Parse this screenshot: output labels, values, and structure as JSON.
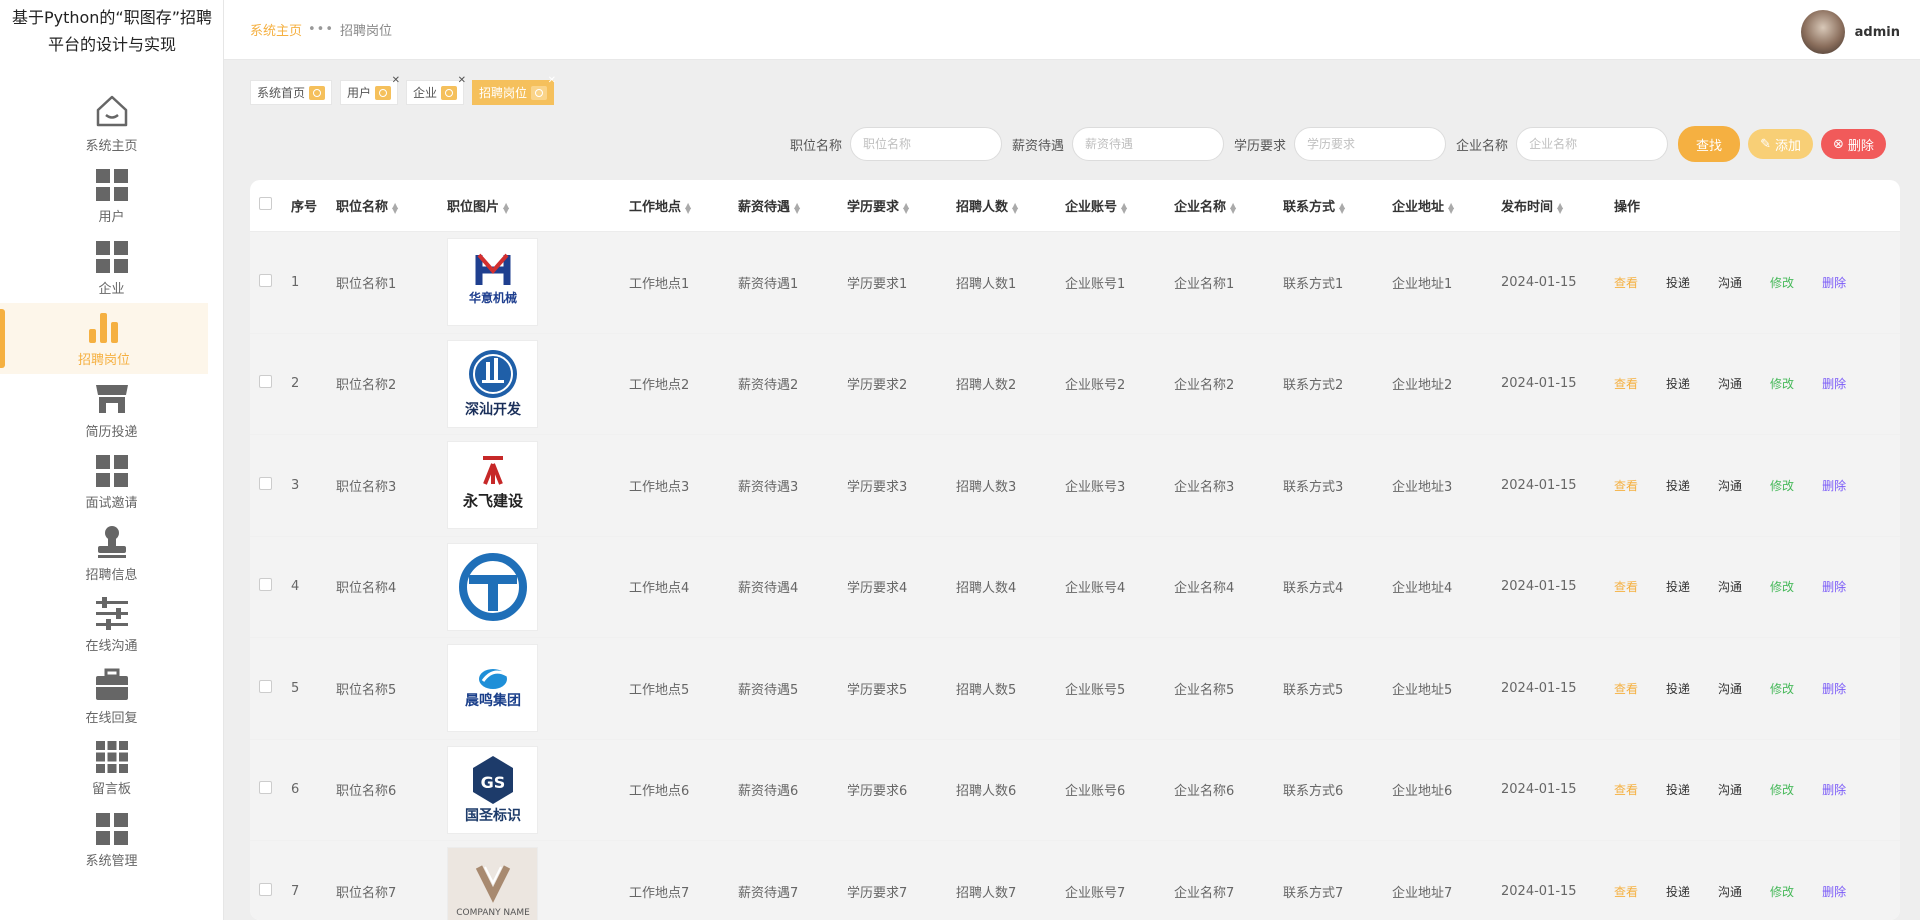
{
  "app": {
    "title": "基于Python的“职图存”招聘平台的设计与实现"
  },
  "sidebar": {
    "items": [
      {
        "label": "系统主页",
        "icon": "house-icon",
        "active": false
      },
      {
        "label": "用户",
        "icon": "grid-icon",
        "active": false
      },
      {
        "label": "企业",
        "icon": "grid-icon",
        "active": false
      },
      {
        "label": "招聘岗位",
        "icon": "bar-chart-icon",
        "active": true
      },
      {
        "label": "简历投递",
        "icon": "shop-icon",
        "active": false
      },
      {
        "label": "面试邀请",
        "icon": "grid-icon",
        "active": false
      },
      {
        "label": "招聘信息",
        "icon": "stamp-icon",
        "active": false
      },
      {
        "label": "在线沟通",
        "icon": "sliders-icon",
        "active": false
      },
      {
        "label": "在线回复",
        "icon": "briefcase-icon",
        "active": false
      },
      {
        "label": "留言板",
        "icon": "grid9-icon",
        "active": false
      },
      {
        "label": "系统管理",
        "icon": "grid-icon",
        "active": false
      }
    ]
  },
  "header": {
    "breadcrumb": {
      "home": "系统主页",
      "separator": "•••",
      "current": "招聘岗位"
    },
    "user": {
      "name": "admin"
    }
  },
  "tags": [
    {
      "label": "系统首页",
      "closable": false,
      "active": false
    },
    {
      "label": "用户",
      "closable": true,
      "active": false
    },
    {
      "label": "企业",
      "closable": true,
      "active": false
    },
    {
      "label": "招聘岗位",
      "closable": true,
      "active": true
    }
  ],
  "search": {
    "fields": [
      {
        "label": "职位名称",
        "placeholder": "职位名称"
      },
      {
        "label": "薪资待遇",
        "placeholder": "薪资待遇"
      },
      {
        "label": "学历要求",
        "placeholder": "学历要求"
      },
      {
        "label": "企业名称",
        "placeholder": "企业名称"
      }
    ],
    "search_label": "查找",
    "add_label": "添加",
    "delete_label": "删除"
  },
  "table": {
    "columns": [
      "序号",
      "职位名称",
      "职位图片",
      "工作地点",
      "薪资待遇",
      "学历要求",
      "招聘人数",
      "企业账号",
      "企业名称",
      "联系方式",
      "企业地址",
      "发布时间",
      "操作"
    ],
    "ops": {
      "view": "查看",
      "deliver": "投递",
      "chat": "沟通",
      "edit": "修改",
      "delete": "删除"
    },
    "rows": [
      {
        "no": "1",
        "name": "职位名称1",
        "logo": "华意机械",
        "location": "工作地点1",
        "salary": "薪资待遇1",
        "education": "学历要求1",
        "count": "招聘人数1",
        "account": "企业账号1",
        "company": "企业名称1",
        "contact": "联系方式1",
        "address": "企业地址1",
        "time": "2024-01-15"
      },
      {
        "no": "2",
        "name": "职位名称2",
        "logo": "深汕开发",
        "location": "工作地点2",
        "salary": "薪资待遇2",
        "education": "学历要求2",
        "count": "招聘人数2",
        "account": "企业账号2",
        "company": "企业名称2",
        "contact": "联系方式2",
        "address": "企业地址2",
        "time": "2024-01-15"
      },
      {
        "no": "3",
        "name": "职位名称3",
        "logo": "永飞建设",
        "location": "工作地点3",
        "salary": "薪资待遇3",
        "education": "学历要求3",
        "count": "招聘人数3",
        "account": "企业账号3",
        "company": "企业名称3",
        "contact": "联系方式3",
        "address": "企业地址3",
        "time": "2024-01-15"
      },
      {
        "no": "4",
        "name": "职位名称4",
        "logo": "",
        "location": "工作地点4",
        "salary": "薪资待遇4",
        "education": "学历要求4",
        "count": "招聘人数4",
        "account": "企业账号4",
        "company": "企业名称4",
        "contact": "联系方式4",
        "address": "企业地址4",
        "time": "2024-01-15"
      },
      {
        "no": "5",
        "name": "职位名称5",
        "logo": "晨鸣集团",
        "location": "工作地点5",
        "salary": "薪资待遇5",
        "education": "学历要求5",
        "count": "招聘人数5",
        "account": "企业账号5",
        "company": "企业名称5",
        "contact": "联系方式5",
        "address": "企业地址5",
        "time": "2024-01-15"
      },
      {
        "no": "6",
        "name": "职位名称6",
        "logo": "国圣标识",
        "location": "工作地点6",
        "salary": "薪资待遇6",
        "education": "学历要求6",
        "count": "招聘人数6",
        "account": "企业账号6",
        "company": "企业名称6",
        "contact": "联系方式6",
        "address": "企业地址6",
        "time": "2024-01-15"
      },
      {
        "no": "7",
        "name": "职位名称7",
        "logo": "COMPANY NAME",
        "location": "工作地点7",
        "salary": "薪资待遇7",
        "education": "学历要求7",
        "count": "招聘人数7",
        "account": "企业账号7",
        "company": "企业名称7",
        "contact": "联系方式7",
        "address": "企业地址7",
        "time": "2024-01-15"
      }
    ]
  },
  "colors": {
    "accent": "#f5b041",
    "edit": "#47b95a",
    "delete": "#7a5af8",
    "danger": "#f15a5a"
  }
}
